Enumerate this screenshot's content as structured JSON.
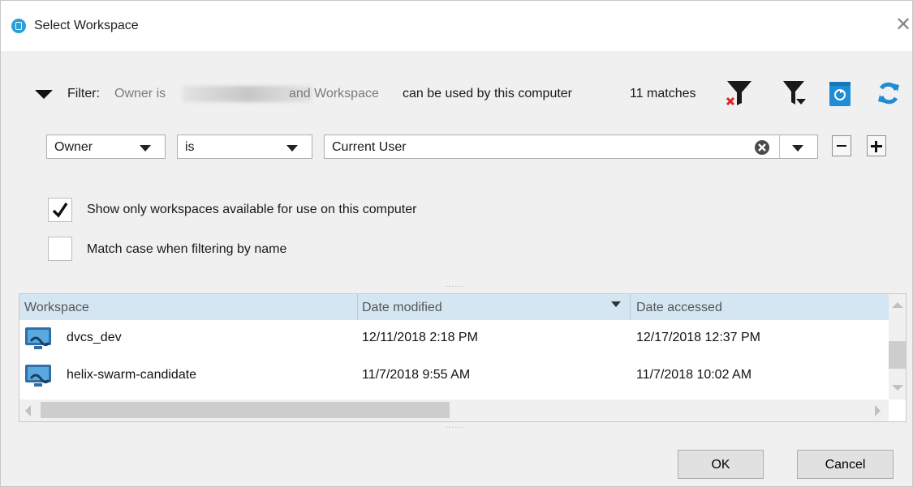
{
  "window": {
    "title": "Select Workspace",
    "icon": "app-logo-icon"
  },
  "filter": {
    "label": "Filter:",
    "owner_part": "Owner is",
    "and_workspace": "and Workspace",
    "can_be_used": "can be used by this computer",
    "matches": "11 matches",
    "icons": [
      "clear-filter-icon",
      "filter-options-icon",
      "recycle-bin-icon",
      "refresh-icon"
    ]
  },
  "condition": {
    "field": "Owner",
    "operator": "is",
    "value": "Current User"
  },
  "options": {
    "show_available": {
      "label": "Show only workspaces available for use on this computer",
      "checked": true
    },
    "match_case": {
      "label": "Match case when filtering by name",
      "checked": false
    }
  },
  "table": {
    "columns": [
      "Workspace",
      "Date modified",
      "Date accessed"
    ],
    "sorted_column": "Date modified",
    "rows": [
      {
        "workspace": "dvcs_dev",
        "modified": "12/11/2018 2:18 PM",
        "accessed": "12/17/2018 12:37 PM"
      },
      {
        "workspace": "helix-swarm-candidate",
        "modified": "11/7/2018 9:55 AM",
        "accessed": "11/7/2018 10:02 AM"
      }
    ]
  },
  "buttons": {
    "ok": "OK",
    "cancel": "Cancel"
  },
  "colors": {
    "accent": "#1f8dd6",
    "header_bg": "#d5e6f3",
    "clear_red": "#d9262b"
  }
}
